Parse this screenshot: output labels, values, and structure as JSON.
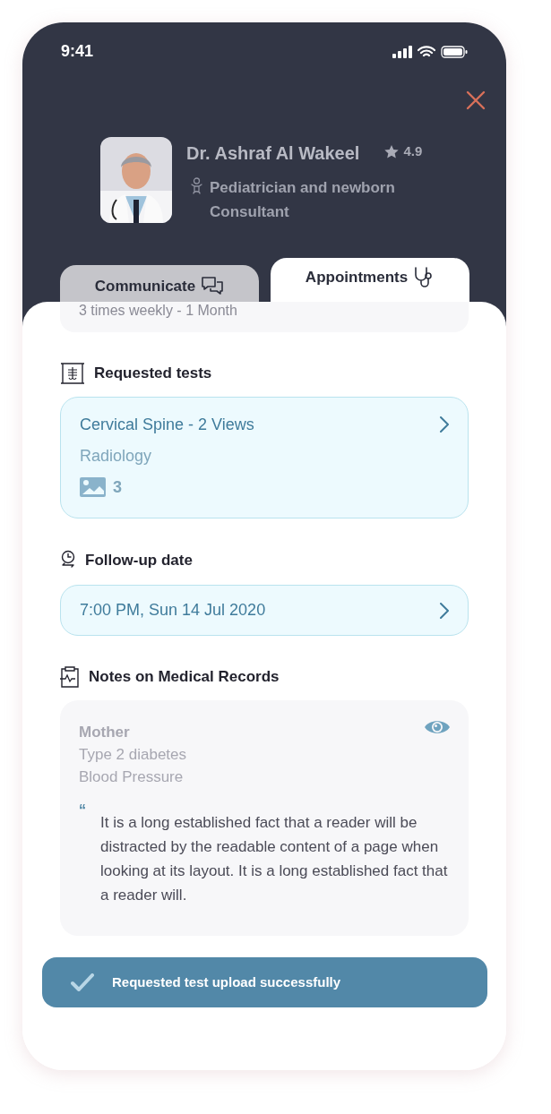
{
  "status_bar": {
    "time": "9:41"
  },
  "doctor": {
    "name": "Dr. Ashraf Al Wakeel",
    "rating": "4.9",
    "specialty": "Pediatrician and newborn Consultant"
  },
  "tabs": [
    {
      "label": "Communicate",
      "selected": false
    },
    {
      "label": "Appointments",
      "selected": true
    }
  ],
  "prescription": {
    "duration": "3 times weekly - 1 Month"
  },
  "requested_tests": {
    "heading": "Requested tests",
    "items": [
      {
        "title": "Cervical Spine - 2 Views",
        "category": "Radiology",
        "image_count": "3"
      }
    ]
  },
  "follow_up": {
    "heading": "Follow-up date",
    "date": "7:00 PM, Sun 14 Jul 2020"
  },
  "notes": {
    "heading": "Notes on Medical Records",
    "relation": "Mother",
    "conditions": [
      "Type 2 diabetes",
      "Blood Pressure"
    ],
    "quote_mark": "“",
    "text": "It is a long established fact that a reader will be distracted by the readable content of a page when looking at its layout. It is a long established fact that a reader will."
  },
  "toast": {
    "message": "Requested test upload successfully"
  }
}
